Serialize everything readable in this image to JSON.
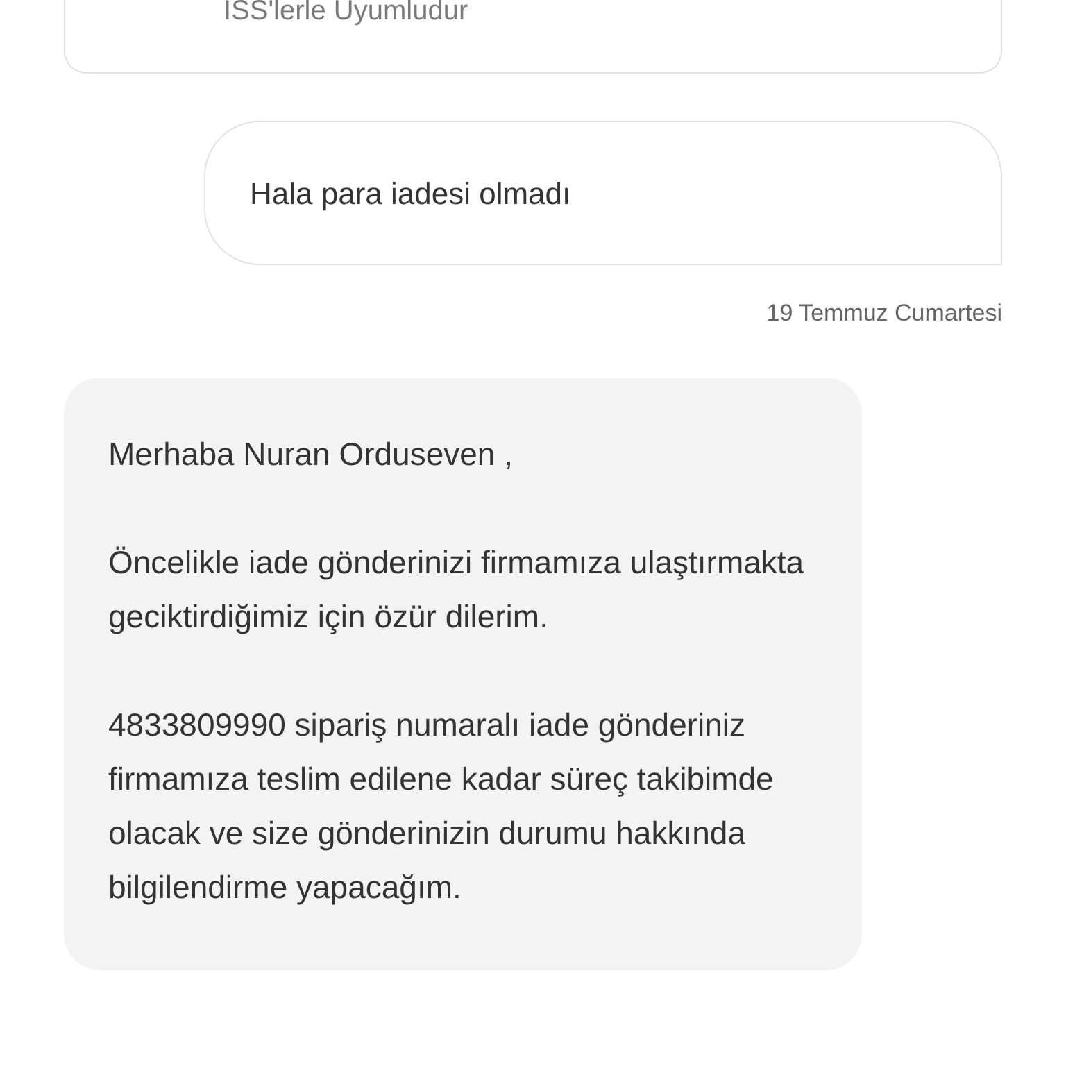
{
  "previous_card": {
    "text": "ISS'lerle Uyumludur"
  },
  "user_message": {
    "text": "Hala para iadesi olmadı",
    "date": "19 Temmuz Cumartesi"
  },
  "agent_message": {
    "paragraphs": [
      "Merhaba Nuran Orduseven ,",
      "Öncelikle iade gönderinizi firmamıza ulaştırmakta geciktirdiğimiz için özür dilerim.",
      "4833809990 sipariş numaralı iade gönderiniz firmamıza teslim edilene kadar süreç takibimde olacak ve size gönderinizin durumu hakkında bilgilendirme yapacağım."
    ]
  }
}
